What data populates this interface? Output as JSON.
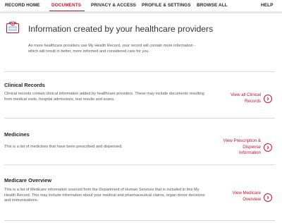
{
  "nav": {
    "items": [
      {
        "label": "RECORD HOME",
        "active": false
      },
      {
        "label": "DOCUMENTS",
        "active": true
      },
      {
        "label": "PRIVACY & ACCESS",
        "active": false
      },
      {
        "label": "PROFILE & SETTINGS",
        "active": false
      },
      {
        "label": "BROWSE ALL",
        "active": false
      }
    ],
    "help": "HELP"
  },
  "hero": {
    "title": "Information created by your healthcare providers",
    "description": "As more healthcare providers use My Health Record, your record will contain more information - which will result in better, more informed and considered care for you.",
    "icon": "medical-documents-icon"
  },
  "sections": [
    {
      "title": "Clinical Records",
      "description": "Clinical records contain clinical information added by healthcare providers. These may include documents resulting from medical visits, hospital admissions, test results and scans.",
      "link_lines": [
        "View all Clinical",
        "Records"
      ]
    },
    {
      "title": "Medicines",
      "description": "This is a list of medicines that have been prescribed and dispensed.",
      "link_lines": [
        "View Prescription &",
        "Dispense",
        "Information"
      ]
    },
    {
      "title": "Medicare Overview",
      "description": "This is a list of Medicare information sourced from the Department of Human Services that is included in this My Health Record. This may include information about your medical and pharmaceutical claims, organ donor decisions and immunisations.",
      "link_lines": [
        "View Medicare",
        "Overview"
      ]
    }
  ],
  "colors": {
    "accent": "#c8102e",
    "divider": "#d9d9d9",
    "text": "#333333"
  }
}
